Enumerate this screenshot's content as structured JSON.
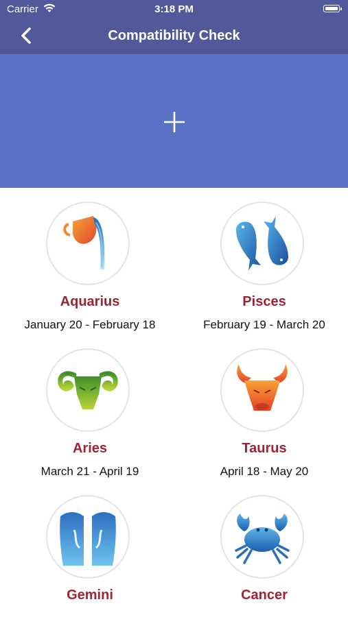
{
  "status_bar": {
    "carrier": "Carrier",
    "time": "3:18 PM"
  },
  "nav": {
    "title": "Compatibility Check",
    "back_icon": "chevron-left-icon"
  },
  "banner": {
    "add_icon": "plus-icon",
    "color": "#5a72c6"
  },
  "colors": {
    "nav": "#51599a",
    "sign_name": "#9c2435"
  },
  "signs": [
    {
      "name": "Aquarius",
      "dates": "January 20 - February 18",
      "icon": "aquarius-icon"
    },
    {
      "name": "Pisces",
      "dates": "February 19 - March 20",
      "icon": "pisces-icon"
    },
    {
      "name": "Aries",
      "dates": "March 21 - April 19",
      "icon": "aries-icon"
    },
    {
      "name": "Taurus",
      "dates": "April 18 - May 20",
      "icon": "taurus-icon"
    },
    {
      "name": "Gemini",
      "dates": "",
      "icon": "gemini-icon"
    },
    {
      "name": "Cancer",
      "dates": "",
      "icon": "cancer-icon"
    }
  ]
}
